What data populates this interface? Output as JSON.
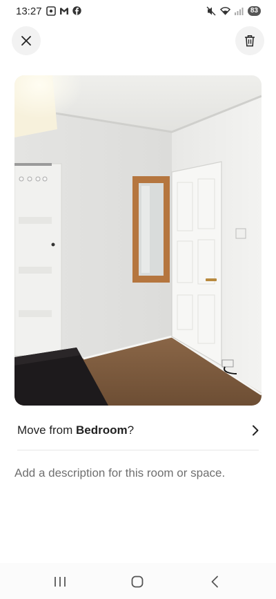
{
  "status_bar": {
    "time": "13:27",
    "left_icons": [
      "screenshot-icon",
      "gmail-icon",
      "facebook-icon"
    ],
    "right_icons": [
      "mute-icon",
      "wifi-icon",
      "signal-icon"
    ],
    "battery": "83"
  },
  "top_bar": {
    "close_icon": "close-icon",
    "delete_icon": "trash-icon"
  },
  "photo": {
    "subject": "room-photo"
  },
  "move_row": {
    "prefix": "Move from ",
    "room": "Bedroom",
    "suffix": "?",
    "chevron_icon": "chevron-right-icon"
  },
  "description": {
    "placeholder": "Add a description for this room or space.",
    "value": ""
  },
  "nav_bar": {
    "recent_icon": "recent-apps-icon",
    "home_icon": "home-icon",
    "back_icon": "back-icon"
  },
  "colors": {
    "button_bg": "#f2f2f2",
    "text": "#222222",
    "placeholder": "#6f6f6f",
    "divider": "#e6e6e6"
  }
}
